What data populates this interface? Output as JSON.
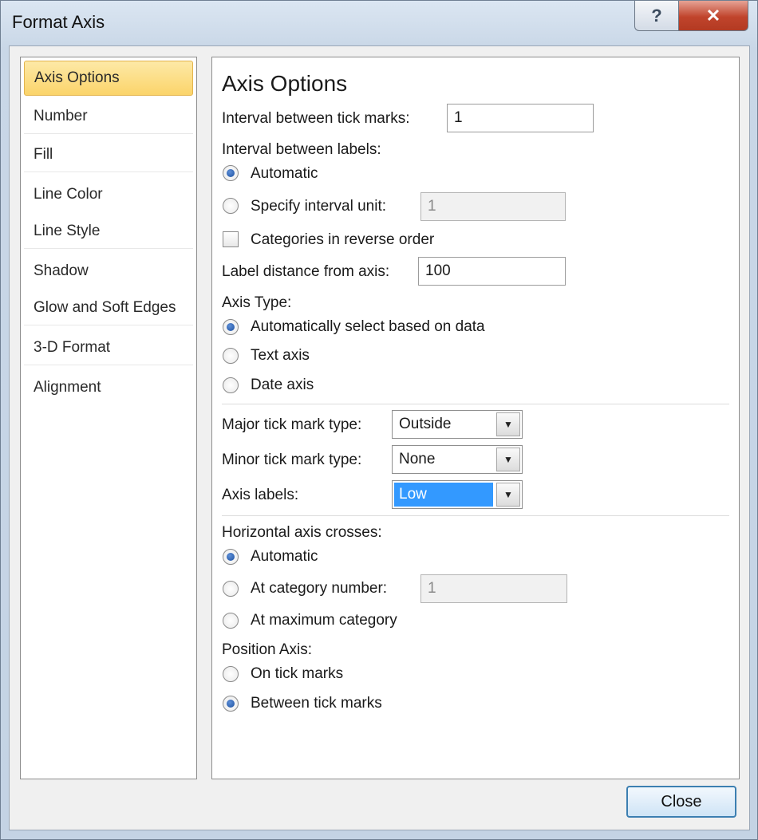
{
  "window": {
    "title": "Format Axis",
    "help_glyph": "?",
    "close_glyph": "✕"
  },
  "nav": {
    "items": [
      {
        "label": "Axis Options",
        "selected": true
      },
      {
        "label": "Number"
      },
      {
        "label": "Fill"
      },
      {
        "label": "Line Color"
      },
      {
        "label": "Line Style"
      },
      {
        "label": "Shadow"
      },
      {
        "label": "Glow and Soft Edges"
      },
      {
        "label": "3-D Format"
      },
      {
        "label": "Alignment"
      }
    ]
  },
  "panel": {
    "heading": "Axis Options",
    "interval_tick_label": "Interval between tick marks:",
    "interval_tick_value": "1",
    "interval_labels_label": "Interval between labels:",
    "interval_labels_options": [
      "Automatic",
      "Specify interval unit:"
    ],
    "interval_labels_selected": "Automatic",
    "interval_unit_value": "1",
    "reverse_order_label": "Categories in reverse order",
    "reverse_order_checked": false,
    "label_distance_label": "Label distance from axis:",
    "label_distance_value": "100",
    "axis_type_label": "Axis Type:",
    "axis_type_options": [
      "Automatically select based on data",
      "Text axis",
      "Date axis"
    ],
    "axis_type_selected": "Automatically select based on data",
    "major_tick_label": "Major tick mark type:",
    "major_tick_value": "Outside",
    "minor_tick_label": "Minor tick mark type:",
    "minor_tick_value": "None",
    "axis_labels_label": "Axis labels:",
    "axis_labels_value": "Low",
    "crosses_label": "Horizontal axis crosses:",
    "crosses_options": [
      "Automatic",
      "At category number:",
      "At maximum category"
    ],
    "crosses_selected": "Automatic",
    "category_number_value": "1",
    "position_axis_label": "Position Axis:",
    "position_options": [
      "On tick marks",
      "Between tick marks"
    ],
    "position_selected": "Between tick marks"
  },
  "footer": {
    "close_label": "Close"
  },
  "colors": {
    "selected_nav": "#fbd46a",
    "highlight": "#3399ff",
    "close_button": "#c0442c"
  }
}
